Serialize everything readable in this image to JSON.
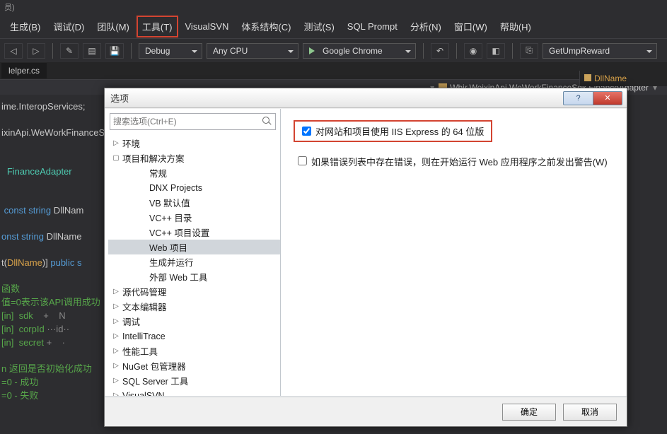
{
  "ide": {
    "title_fragment": "员)",
    "menu": [
      {
        "label": "生成(B)",
        "name": "menu-build"
      },
      {
        "label": "调试(D)",
        "name": "menu-debug"
      },
      {
        "label": "团队(M)",
        "name": "menu-team"
      },
      {
        "label": "工具(T)",
        "name": "menu-tools",
        "highlight": true
      },
      {
        "label": "VisualSVN",
        "name": "menu-visualsvn"
      },
      {
        "label": "体系结构(C)",
        "name": "menu-architecture"
      },
      {
        "label": "测试(S)",
        "name": "menu-test"
      },
      {
        "label": "SQL Prompt",
        "name": "menu-sqlprompt"
      },
      {
        "label": "分析(N)",
        "name": "menu-analyze"
      },
      {
        "label": "窗口(W)",
        "name": "menu-window"
      },
      {
        "label": "帮助(H)",
        "name": "menu-help"
      }
    ],
    "toolbar": {
      "config": "Debug",
      "platform": "Any CPU",
      "browser": "Google Chrome",
      "member": "GetUmpReward"
    },
    "tab": "lelper.cs",
    "breadcrumb": "Whir.WeixinApi.WeWorkFinanceSdk.FinanceAdapter",
    "right_pane": "DllName"
  },
  "code": {
    "l1": "ime.InteropServices;",
    "l2": "ixinApi.WeWorkFinanceS",
    "l3": "FinanceAdapter",
    "l4a": " const string ",
    "l4b": "DllNam",
    "l5a": "onst string ",
    "l5b": "DllName ",
    "l6a": "t(",
    "l6b": "DllName",
    "l6c": ")] ",
    "l6d": "public s",
    "l7": "函数",
    "l8": "值=0表示该API调用成功",
    "l9a": "[in]  sdk",
    "l9b": "    +    N",
    "l10a": "[in]  corpId",
    "l10b": " ···id··",
    "l11a": "[in]  secret",
    "l11b": " +    ·",
    "l12": "n 返回是否初始化成功",
    "l13": "=0 - 成功",
    "l14": "=0 - 失败"
  },
  "dialog": {
    "title": "选项",
    "search_placeholder": "搜索选项(Ctrl+E)",
    "tree": [
      {
        "label": "环境",
        "arrow": "▷",
        "lvl": 0,
        "name": "tree-environment"
      },
      {
        "label": "项目和解决方案",
        "arrow": "▢",
        "lvl": 0,
        "name": "tree-projects"
      },
      {
        "label": "常规",
        "lvl": 2,
        "name": "tree-general"
      },
      {
        "label": "DNX Projects",
        "lvl": 2,
        "name": "tree-dnx"
      },
      {
        "label": "VB 默认值",
        "lvl": 2,
        "name": "tree-vb"
      },
      {
        "label": "VC++ 目录",
        "lvl": 2,
        "name": "tree-vcdir"
      },
      {
        "label": "VC++ 项目设置",
        "lvl": 2,
        "name": "tree-vcproj"
      },
      {
        "label": "Web 项目",
        "lvl": 2,
        "name": "tree-webproj",
        "selected": true
      },
      {
        "label": "生成并运行",
        "lvl": 2,
        "name": "tree-buildrun"
      },
      {
        "label": "外部 Web 工具",
        "lvl": 2,
        "name": "tree-extweb"
      },
      {
        "label": "源代码管理",
        "arrow": "▷",
        "lvl": 0,
        "name": "tree-scc"
      },
      {
        "label": "文本编辑器",
        "arrow": "▷",
        "lvl": 0,
        "name": "tree-texteditor"
      },
      {
        "label": "调试",
        "arrow": "▷",
        "lvl": 0,
        "name": "tree-debug"
      },
      {
        "label": "IntelliTrace",
        "arrow": "▷",
        "lvl": 0,
        "name": "tree-intellitrace"
      },
      {
        "label": "性能工具",
        "arrow": "▷",
        "lvl": 0,
        "name": "tree-perf"
      },
      {
        "label": "NuGet 包管理器",
        "arrow": "▷",
        "lvl": 0,
        "name": "tree-nuget"
      },
      {
        "label": "SQL Server 工具",
        "arrow": "▷",
        "lvl": 0,
        "name": "tree-sqlserver"
      },
      {
        "label": "VisualSVN",
        "arrow": "▷",
        "lvl": 0,
        "name": "tree-visualsvn"
      }
    ],
    "opt1": "对网站和项目使用 IIS Express 的 64 位版",
    "opt1_checked": true,
    "opt2": "如果错误列表中存在错误，则在开始运行 Web 应用程序之前发出警告(W)",
    "opt2_checked": false,
    "ok": "确定",
    "cancel": "取消"
  }
}
